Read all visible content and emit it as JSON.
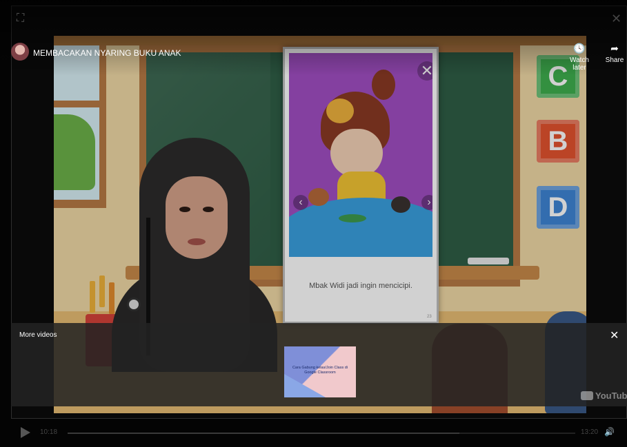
{
  "video": {
    "title": "MEMBACAKAN NYARING BUKU ANAK",
    "watch_later_label": "Watch later",
    "share_label": "Share"
  },
  "scene": {
    "blocks": [
      "C",
      "B",
      "D"
    ],
    "colors": {
      "c": "#3fb04f",
      "b": "#e4532f",
      "d": "#3f86d6"
    }
  },
  "book": {
    "caption": "Mbak Widi jadi ingin mencicipi.",
    "close_glyph": "✕",
    "prev_glyph": "‹",
    "next_glyph": "›",
    "page_number": "23"
  },
  "more_videos": {
    "label": "More videos",
    "close_glyph": "✕",
    "items": [
      {
        "title": "Cara Gabung kelas/Join Class di Google Classroom"
      }
    ]
  },
  "branding": {
    "logo_text": "YouTube"
  },
  "controls": {
    "current_time": "10:18",
    "duration": "13:20",
    "progress": 0.772
  },
  "icons": {
    "collapse": "exit-fullscreen-icon",
    "close": "close-icon",
    "watch_later": "clock-icon",
    "share": "share-arrow-icon",
    "play": "play-icon",
    "volume": "volume-icon"
  }
}
